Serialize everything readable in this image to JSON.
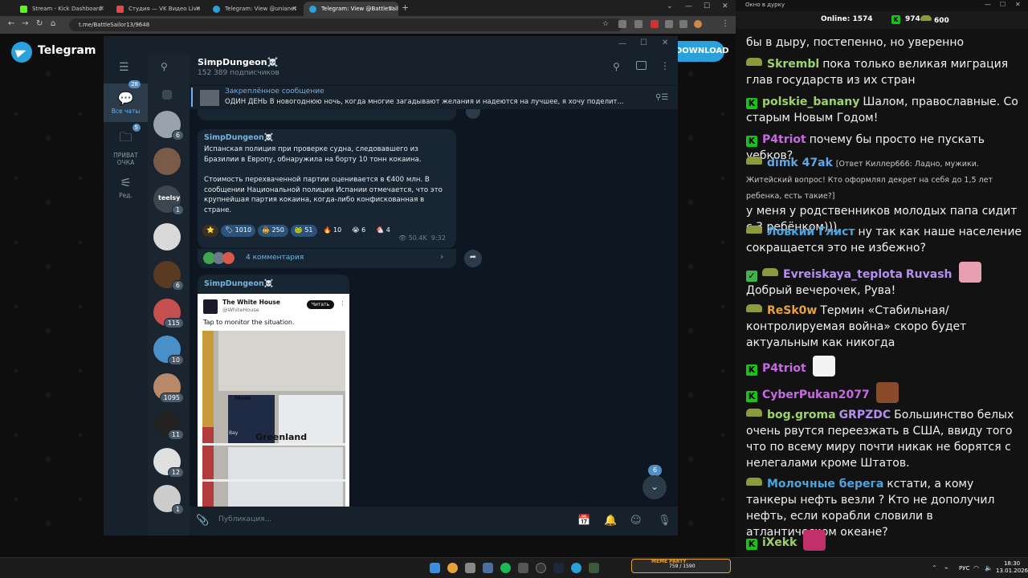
{
  "browser": {
    "tabs": [
      {
        "title": "Stream - Kick Dashboard",
        "color": "#53fc18"
      },
      {
        "title": "Студия — VK Видео Live",
        "color": "#e64646"
      },
      {
        "title": "Telegram: View @unianet",
        "color": "#2aa1da"
      },
      {
        "title": "Telegram: View @BattleSailor13",
        "color": "#2aa1da"
      }
    ],
    "url": "t.me/BattleSailor13/9648",
    "new_tab": "+"
  },
  "telegram_web": {
    "brand": "Telegram",
    "download_label": "DOWNLOAD"
  },
  "folders": [
    {
      "label": "Все чаты",
      "badge": "28",
      "icon": "chats-icon"
    },
    {
      "label": "ПРИВАТ ОЧКА",
      "badge": "5",
      "icon": "folder-icon"
    },
    {
      "label": "Ред.",
      "badge": "",
      "icon": "edit-icon"
    }
  ],
  "chat_list": [
    {
      "badge": "6",
      "color": "#9aa3ad"
    },
    {
      "badge": "",
      "color": "#7a5a48"
    },
    {
      "badge": "1",
      "color": "#3c4650",
      "text": "teelsy"
    },
    {
      "badge": "",
      "color": "#d9d9d9"
    },
    {
      "badge": "6",
      "color": "#5a3a20"
    },
    {
      "badge": "115",
      "color": "#c45050"
    },
    {
      "badge": "10",
      "color": "#4a90c8"
    },
    {
      "badge": "1095",
      "color": "#b88a6a"
    },
    {
      "badge": "11",
      "color": "#222222"
    },
    {
      "badge": "12",
      "color": "#e0e0e0"
    },
    {
      "badge": "1",
      "color": "#cccccc"
    }
  ],
  "chat": {
    "title": "SimpDungeon☠️",
    "subscribers": "152 389 подписчиков",
    "pinned_title": "Закреплённое сообщение",
    "pinned_text": "ОДИН ДЕНЬ  В новогоднюю ночь, когда многие загадывают желания и надеются на лучшее, я хочу поделит...",
    "messages": [
      {
        "sender": "SimpDungeon☠️",
        "text1": "Испанская полиция при проверке судна, следовавшего из Бразилии в Европу, обнаружила на борту 10 тонн кокаина.",
        "text2": "Стоимость перехваченной партии оценивается в €400 млн. В сообщении Национальной полиции Испании отмечается, что это крупнейшая партия кокаина, когда-либо конфискованная в стране.",
        "reactions": [
          {
            "emoji": "⭐",
            "count": ""
          },
          {
            "emoji": "🏷",
            "count": "1010"
          },
          {
            "emoji": "🤠",
            "count": "250"
          },
          {
            "emoji": "🐸",
            "count": "51"
          },
          {
            "emoji": "🔥",
            "count": "10"
          },
          {
            "emoji": "😭",
            "count": "6"
          },
          {
            "emoji": "🐔",
            "count": "4"
          }
        ],
        "views": "50.4K",
        "time": "9:32",
        "comments": "4 комментария"
      },
      {
        "sender": "SimpDungeon☠️",
        "tweet_name": "The White House",
        "tweet_handle": "@WhiteHouse",
        "tweet_button": "Читать",
        "tweet_text": "Tap to monitor the situation.",
        "map_labels": [
          "Thule",
          "Bay",
          "Greenland"
        ]
      }
    ],
    "scroll_badge": "6",
    "composer_placeholder": "Публикация..."
  },
  "stream_chat": {
    "window_title": "Окно в дурку",
    "online_label": "Online:",
    "online": "1574",
    "kick_count": "974",
    "other_count": "600",
    "top_partial": "бы в дыру, постепенно, но уверенно",
    "messages": [
      {
        "user": "Skrembl",
        "color": "#9ed36a",
        "badge": "hat",
        "text": "пока только великая миграция глав государств из их стран"
      },
      {
        "user": "polskie_banany",
        "color": "#9ed36a",
        "badge": "kick",
        "text": "Шалом, православные. Со старым Новым Годом!"
      },
      {
        "user": "P4triot",
        "color": "#c56be0",
        "badge": "kick",
        "text": "почему бы просто не пускать уебков?"
      },
      {
        "user": "dimk 47ak",
        "color": "#5fa8e8",
        "badge": "hat",
        "reply": "[Ответ Киллер666: Ладно, мужики. Житейский вопрос! Кто оформлял декрет на себя до 1,5 лет ребенка, есть такие?]",
        "text": "у меня у родственников молодых папа сидит с 3 ребёнком)))"
      },
      {
        "user": "Ловкий Глист",
        "color": "#4aa5e0",
        "badge": "hat",
        "text": "ну так как наше население сокращается это не избежно?"
      },
      {
        "user": "Evreiskaya_teplota",
        "color": "#b58ff0",
        "badge": "hat",
        "mention": "Ruvash",
        "text": "Добрый вечерочек, Рува!"
      },
      {
        "user": "ReSk0w",
        "color": "#e8a23a",
        "badge": "hat",
        "text": "Термин «Стабильная/контролируемая война» скоро будет актуальным как никогда"
      },
      {
        "user": "P4triot",
        "color": "#c56be0",
        "badge": "kick",
        "text": ""
      },
      {
        "user": "CyberPukan2077",
        "color": "#c56be0",
        "badge": "kick",
        "text": ""
      },
      {
        "user": "bog.groma",
        "color": "#9ed36a",
        "badge": "hat",
        "mention": "GRPZDC",
        "text": "Большинство белых очень рвутся переезжать в США, ввиду того что по всему миру почти никак не борятся с нелегалами кроме Штатов."
      },
      {
        "user": "Молочные берега",
        "color": "#4aa5e0",
        "badge": "hat",
        "text": "кстати, а кому танкеры нефть везли ? Кто не дополучил нефть, если корабли словили в атлантическом океане?"
      },
      {
        "user": "iXekk",
        "color": "#9ed36a",
        "badge": "kick",
        "text": ""
      }
    ]
  },
  "taskbar": {
    "meme_label": "MEME PARTY",
    "meme_progress": "759 / 1590",
    "lang": "РУС",
    "time": "18:30",
    "date": "13.01.2026"
  }
}
